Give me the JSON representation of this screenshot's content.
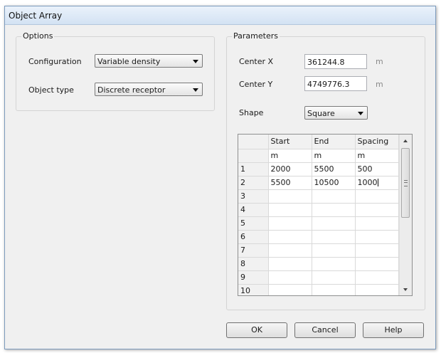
{
  "window": {
    "title": "Object Array"
  },
  "options": {
    "group_title": "Options",
    "configuration_label": "Configuration",
    "configuration_value": "Variable density",
    "object_type_label": "Object type",
    "object_type_value": "Discrete receptor"
  },
  "parameters": {
    "group_title": "Parameters",
    "center_x_label": "Center X",
    "center_x_value": "361244.8",
    "center_x_unit": "m",
    "center_y_label": "Center Y",
    "center_y_value": "4749776.3",
    "center_y_unit": "m",
    "shape_label": "Shape",
    "shape_value": "Square"
  },
  "table": {
    "columns": [
      "Start",
      "End",
      "Spacing"
    ],
    "units": [
      "m",
      "m",
      "m"
    ],
    "rows": [
      {
        "num": "1",
        "start": "2000",
        "end": "5500",
        "spacing": "500"
      },
      {
        "num": "2",
        "start": "5500",
        "end": "10500",
        "spacing": "1000"
      },
      {
        "num": "3",
        "start": "",
        "end": "",
        "spacing": ""
      },
      {
        "num": "4",
        "start": "",
        "end": "",
        "spacing": ""
      },
      {
        "num": "5",
        "start": "",
        "end": "",
        "spacing": ""
      },
      {
        "num": "6",
        "start": "",
        "end": "",
        "spacing": ""
      },
      {
        "num": "7",
        "start": "",
        "end": "",
        "spacing": ""
      },
      {
        "num": "8",
        "start": "",
        "end": "",
        "spacing": ""
      },
      {
        "num": "9",
        "start": "",
        "end": "",
        "spacing": ""
      },
      {
        "num": "10",
        "start": "",
        "end": "",
        "spacing": ""
      }
    ]
  },
  "buttons": {
    "ok": "OK",
    "cancel": "Cancel",
    "help": "Help"
  }
}
